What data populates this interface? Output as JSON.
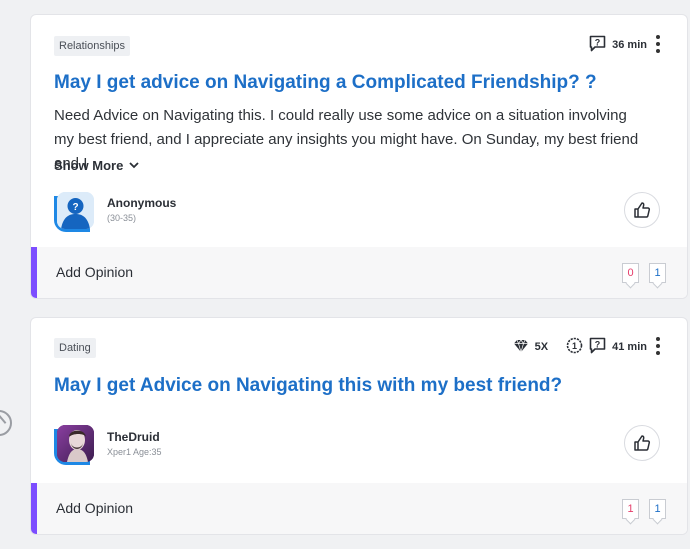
{
  "posts": [
    {
      "tag": "Relationships",
      "time": "36 min",
      "title": "May I get advice on Navigating a Complicated Friendship? ?",
      "excerpt": "Need Advice on Navigating this. I could really use some advice on a situation involving my best friend, and I appreciate any insights you might have. On Sunday, my best friend and I",
      "show_more": "Show More",
      "author": "Anonymous",
      "author_sub": "(30-35)",
      "add_opinion": "Add Opinion",
      "count_a": "0",
      "count_b": "1"
    },
    {
      "tag": "Dating",
      "xp": "5X",
      "time": "41 min",
      "title": "May I get Advice on Navigating this with my best friend?",
      "author": "TheDruid",
      "author_sub": "Xper1 Age:35",
      "add_opinion": "Add Opinion",
      "count_a": "1",
      "count_b": "1"
    }
  ],
  "icons": {
    "comment": "comment-question-icon",
    "kebab": "more-options-icon",
    "diamond": "diamond-icon",
    "level": "level-badge-icon",
    "like": "thumbs-up-icon",
    "chevron": "chevron-down-icon"
  },
  "colors": {
    "title": "#1d6fc7",
    "accent": "#7c4dff",
    "avatar_blue": "#1e88e5",
    "count_pink": "#e53d6a"
  }
}
